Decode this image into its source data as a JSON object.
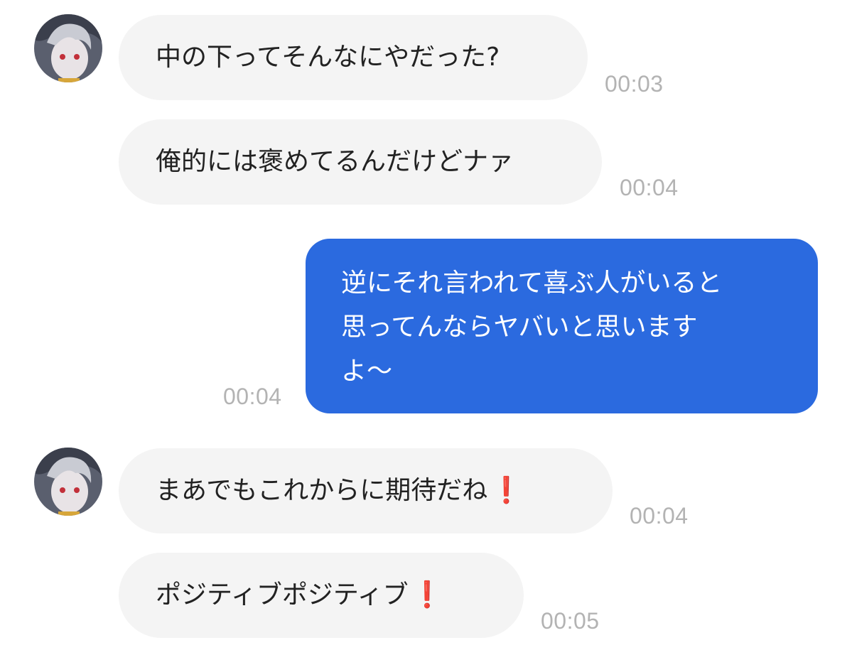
{
  "chat": {
    "messages": [
      {
        "sender": "them",
        "text": "中の下ってそんなにやだった?",
        "time": "00:03"
      },
      {
        "sender": "them",
        "text": "俺的には褒めてるんだけどナァ",
        "time": "00:04"
      },
      {
        "sender": "me",
        "lines": [
          "逆にそれ言われて喜ぶ人がいると",
          "思ってんならヤバいと思います",
          "よ〜"
        ],
        "time": "00:04"
      },
      {
        "sender": "them",
        "text": "まあでもこれからに期待だね",
        "emoji": "❗",
        "time": "00:04"
      },
      {
        "sender": "them",
        "text": "ポジティブポジティブ",
        "emoji": "❗",
        "time": "00:05"
      }
    ]
  },
  "colors": {
    "incoming_bubble": "#f4f4f4",
    "outgoing_bubble": "#2b6adf",
    "timestamp": "#b3b3b3",
    "exclamation": "#e0202a"
  },
  "icons": {
    "avatar": "avatar-icon"
  }
}
